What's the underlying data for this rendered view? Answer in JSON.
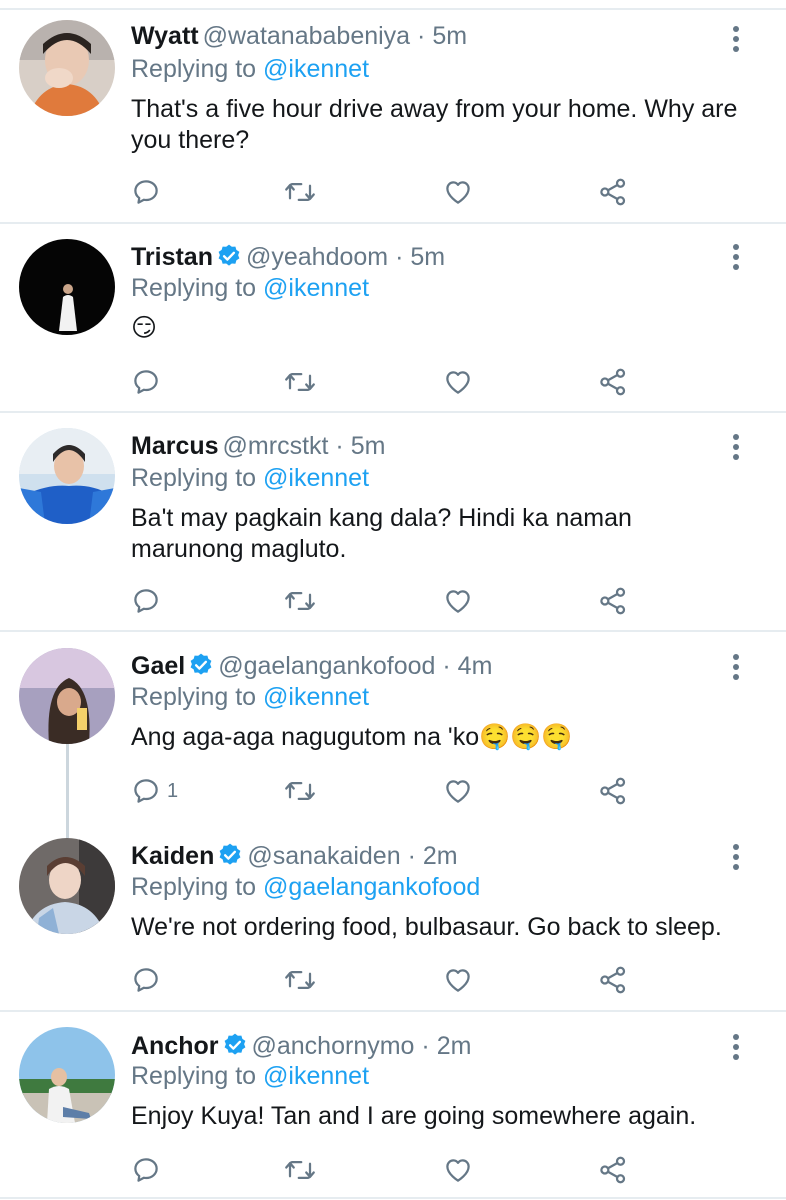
{
  "colors": {
    "accent": "#1da1f2",
    "muted": "#657786",
    "text": "#14171a",
    "divider": "#e6ecf0"
  },
  "icons": [
    "reply-icon",
    "retweet-icon",
    "like-icon",
    "share-icon",
    "more-options-icon",
    "verified-badge-icon"
  ],
  "tweets": [
    {
      "name": "Wyatt",
      "verified": false,
      "handle": "@watanababeniya",
      "separator": "·",
      "time": "5m",
      "replying_prefix": "Replying to ",
      "replying_to": "@ikennet",
      "text": "That's a five hour drive away from your home. Why are you there?",
      "reply_count": ""
    },
    {
      "name": "Tristan",
      "verified": true,
      "handle": "@yeahdoom",
      "separator": "·",
      "time": "5m",
      "replying_prefix": "Replying to ",
      "replying_to": "@ikennet",
      "text": "😏",
      "reply_count": ""
    },
    {
      "name": "Marcus",
      "verified": false,
      "handle": "@mrcstkt",
      "separator": "·",
      "time": "5m",
      "replying_prefix": "Replying to ",
      "replying_to": "@ikennet",
      "text": "Ba't may pagkain kang dala? Hindi ka naman marunong magluto.",
      "reply_count": ""
    },
    {
      "name": "Gael",
      "verified": true,
      "handle": "@gaelangankofood",
      "separator": "·",
      "time": "4m",
      "replying_prefix": "Replying to ",
      "replying_to": "@ikennet",
      "text": "Ang aga-aga nagugutom na 'ko🤤🤤🤤",
      "reply_count": "1"
    },
    {
      "name": "Kaiden",
      "verified": true,
      "handle": "@sanakaiden",
      "separator": "·",
      "time": "2m",
      "replying_prefix": "Replying to ",
      "replying_to": "@gaelangankofood",
      "text": "We're not ordering food, bulbasaur. Go back to sleep.",
      "reply_count": ""
    },
    {
      "name": "Anchor",
      "verified": true,
      "handle": "@anchornymo",
      "separator": "·",
      "time": "2m",
      "replying_prefix": "Replying to ",
      "replying_to": "@ikennet",
      "text": "Enjoy Kuya! Tan and I are going somewhere again.",
      "reply_count": ""
    }
  ]
}
